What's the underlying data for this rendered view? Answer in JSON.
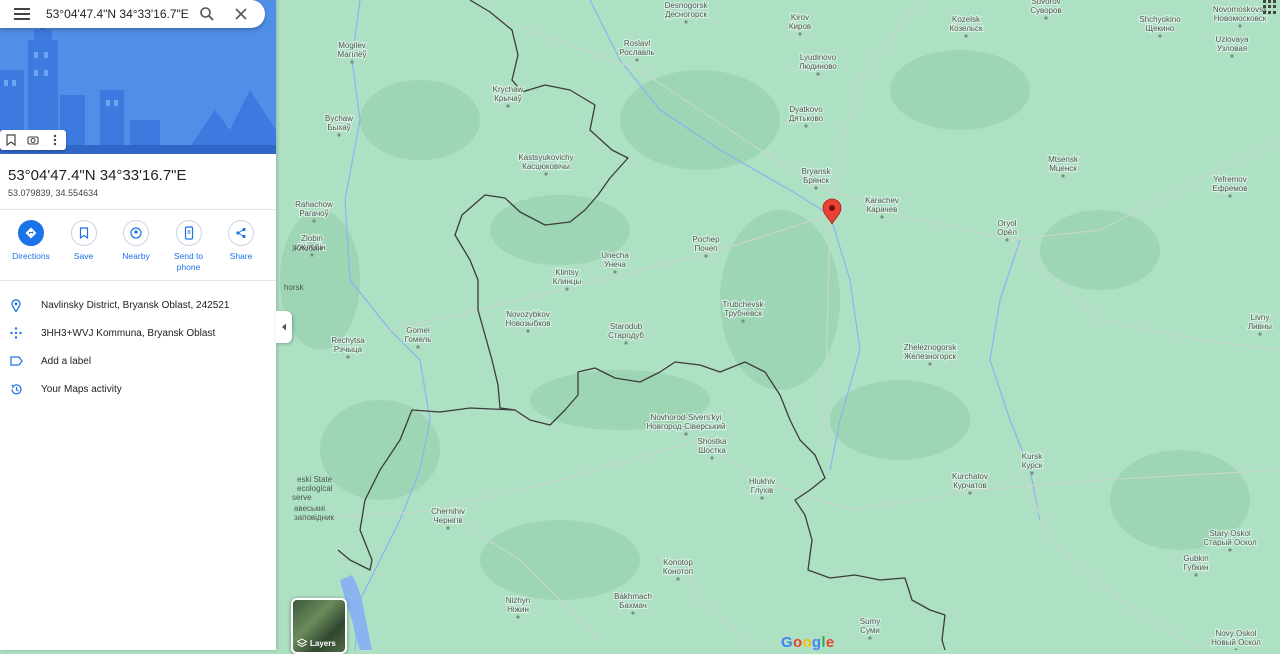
{
  "search": {
    "query": "53°04'47.4\"N 34°33'16.7\"E",
    "search_icon": "search-icon",
    "close_icon": "close-icon",
    "menu_icon": "menu-icon"
  },
  "place": {
    "title": "53°04'47.4\"N 34°33'16.7\"E",
    "decimal": "53.079839, 34.554634"
  },
  "actions": [
    {
      "label": "Directions",
      "icon": "directions-icon"
    },
    {
      "label": "Save",
      "icon": "bookmark-icon"
    },
    {
      "label": "Nearby",
      "icon": "nearby-icon"
    },
    {
      "label": "Send to\nphone",
      "label_line1": "Send to",
      "label_line2": "phone",
      "icon": "phone-icon"
    },
    {
      "label": "Share",
      "icon": "share-icon"
    }
  ],
  "details": [
    {
      "text": "Navlinsky District, Bryansk Oblast, 242521",
      "icon": "location-pin-icon"
    },
    {
      "text": "3HH3+WVJ Kommuna, Bryansk Oblast",
      "icon": "plus-code-icon"
    },
    {
      "text": "Add a label",
      "icon": "label-icon"
    },
    {
      "text": "Your Maps activity",
      "icon": "history-icon"
    }
  ],
  "layers_label": "Layers",
  "logo": "Google",
  "colors": {
    "accent": "#1a73e8",
    "pin": "#ea4335",
    "land": "#aee0c4",
    "border": "#3c3c3c"
  },
  "cities": [
    {
      "name": "Desnogorsk",
      "alt": "Десногорск"
    },
    {
      "name": "Kirov",
      "alt": "Киров"
    },
    {
      "name": "Kozelsk",
      "alt": "Козельск"
    },
    {
      "name": "Suvorov",
      "alt": "Суворов"
    },
    {
      "name": "Shchyokino",
      "alt": "Щекино"
    },
    {
      "name": "Novomoskovsk",
      "alt": "Новомосковск"
    },
    {
      "name": "Uzlovaya",
      "alt": "Узловая"
    },
    {
      "name": "Mogilev",
      "alt": "Магілёў"
    },
    {
      "name": "Roslavl",
      "alt": "Рославль"
    },
    {
      "name": "Lyudinovo",
      "alt": "Людиново"
    },
    {
      "name": "Krychaw",
      "alt": "Крычаў"
    },
    {
      "name": "Bychaw",
      "alt": "Быхаў"
    },
    {
      "name": "Dyatkovo",
      "alt": "Дятьково"
    },
    {
      "name": "Kastsyukovichy",
      "alt": "Касцюковічы"
    },
    {
      "name": "Bryansk",
      "alt": "Брянск"
    },
    {
      "name": "Mtsensk",
      "alt": "Мценск"
    },
    {
      "name": "Yefremov",
      "alt": "Ефремов"
    },
    {
      "name": "Karachev",
      "alt": "Карачев"
    },
    {
      "name": "Rahachow",
      "alt": "Рагачоў"
    },
    {
      "name": "Oryol",
      "alt": "Орёл"
    },
    {
      "name": "Zlobin",
      "alt": "Жлобін"
    },
    {
      "name": "Pochep",
      "alt": "Почеп"
    },
    {
      "name": "Unecha",
      "alt": "Унеча"
    },
    {
      "name": "Klintsy",
      "alt": "Клинцы"
    },
    {
      "name": "Novozybkov",
      "alt": "Новозыбков"
    },
    {
      "name": "Trubchevsk",
      "alt": "Трубчевск"
    },
    {
      "name": "Livny",
      "alt": "Ливны"
    },
    {
      "name": "Starodub",
      "alt": "Стародуб"
    },
    {
      "name": "Gomel",
      "alt": "Гомель"
    },
    {
      "name": "Rechytsa",
      "alt": "Рэчыца"
    },
    {
      "name": "Zheleznogorsk",
      "alt": "Железногорск"
    },
    {
      "name": "Novhorod-Sivers'kyi",
      "alt": "Новгород-Сіверський"
    },
    {
      "name": "Shostka",
      "alt": "Шостка"
    },
    {
      "name": "Kursk",
      "alt": "Курск"
    },
    {
      "name": "Kurchatov",
      "alt": "Курчатов"
    },
    {
      "name": "Hlukhiv",
      "alt": "Глухів"
    },
    {
      "name": "Chernihiv",
      "alt": "Чернігів"
    },
    {
      "name": "Stary Oskol",
      "alt": "Старый Оскол"
    },
    {
      "name": "Gubkin",
      "alt": "Губкин"
    },
    {
      "name": "Konotop",
      "alt": "Конотоп"
    },
    {
      "name": "Bakhmach",
      "alt": "Бахмач"
    },
    {
      "name": "Nizhyn",
      "alt": "Ніжин"
    },
    {
      "name": "Sumy",
      "alt": "Суми"
    },
    {
      "name": "Novy Oskol",
      "alt": "Новый Оскол"
    }
  ],
  "partial_labels": [
    "horsk",
    "Жлобин",
    "eski State",
    "ecological",
    "serve",
    "авеськиі",
    "заповідник"
  ]
}
